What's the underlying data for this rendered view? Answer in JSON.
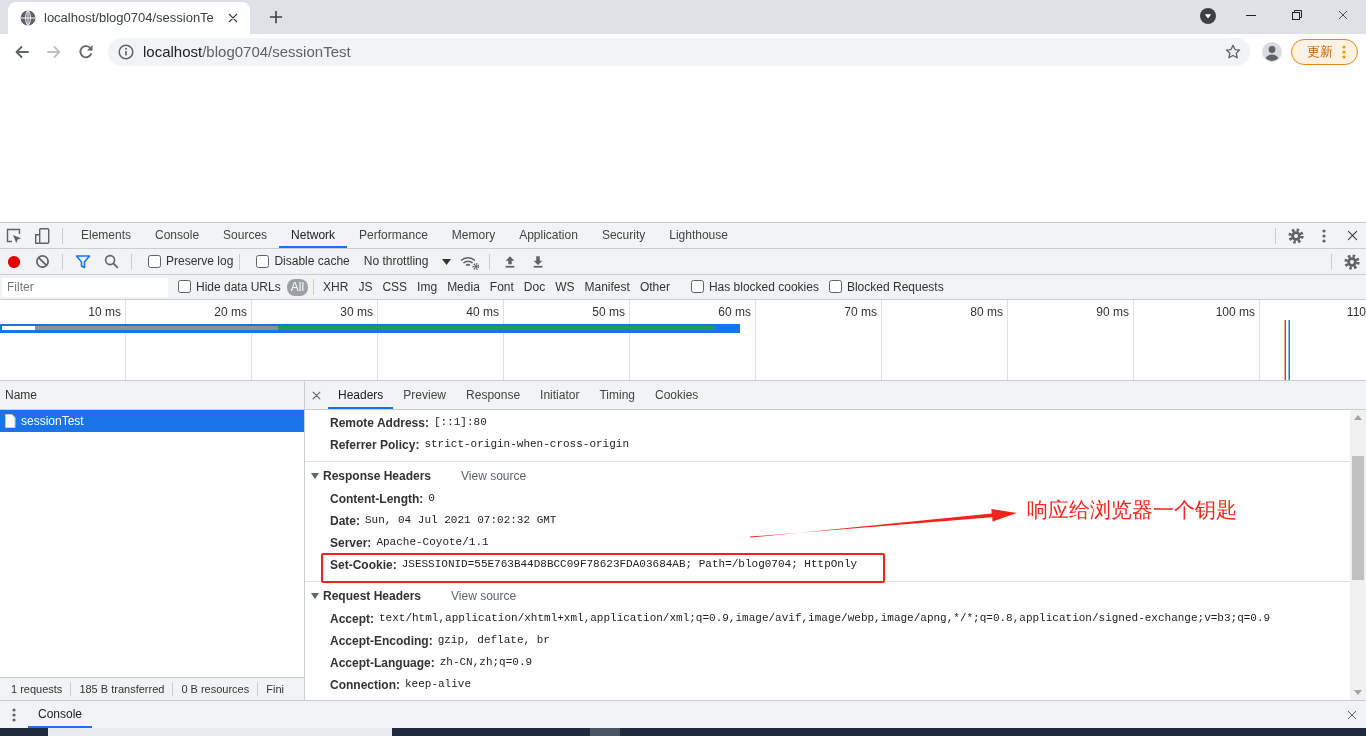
{
  "browser": {
    "tab": {
      "title": "localhost/blog0704/sessionTe"
    },
    "nav_buttons": [
      {
        "kind": "back",
        "disabled": false
      },
      {
        "kind": "forward",
        "disabled": true
      },
      {
        "kind": "reload",
        "disabled": false
      }
    ],
    "address": {
      "host": "localhost",
      "path": "/blog0704/sessionTest"
    },
    "update_button": "更新"
  },
  "devtools": {
    "panel_tabs": [
      {
        "label": "Elements",
        "selected": false
      },
      {
        "label": "Console",
        "selected": false
      },
      {
        "label": "Sources",
        "selected": false
      },
      {
        "label": "Network",
        "selected": true
      },
      {
        "label": "Performance",
        "selected": false
      },
      {
        "label": "Memory",
        "selected": false
      },
      {
        "label": "Application",
        "selected": false
      },
      {
        "label": "Security",
        "selected": false
      },
      {
        "label": "Lighthouse",
        "selected": false
      }
    ],
    "toolbar": {
      "recording": true,
      "filter_active": true,
      "checkboxes": [
        {
          "label": "Preserve log",
          "checked": false
        },
        {
          "label": "Disable cache",
          "checked": false
        }
      ],
      "throttling": "No throttling"
    },
    "filter_bar": {
      "placeholder": "Filter",
      "hide_data_urls": {
        "label": "Hide data URLs",
        "checked": false
      },
      "types": [
        {
          "label": "All",
          "selected": true
        },
        {
          "label": "XHR",
          "selected": false
        },
        {
          "label": "JS",
          "selected": false
        },
        {
          "label": "CSS",
          "selected": false
        },
        {
          "label": "Img",
          "selected": false
        },
        {
          "label": "Media",
          "selected": false
        },
        {
          "label": "Font",
          "selected": false
        },
        {
          "label": "Doc",
          "selected": false
        },
        {
          "label": "WS",
          "selected": false
        },
        {
          "label": "Manifest",
          "selected": false
        },
        {
          "label": "Other",
          "selected": false
        }
      ],
      "options": [
        {
          "label": "Has blocked cookies",
          "checked": false
        },
        {
          "label": "Blocked Requests",
          "checked": false
        }
      ]
    },
    "overview": {
      "ticks": [
        "10 ms",
        "20 ms",
        "30 ms",
        "40 ms",
        "50 ms",
        "60 ms",
        "70 ms",
        "80 ms",
        "90 ms",
        "100 ms",
        "110"
      ]
    },
    "request_list": {
      "column": "Name",
      "rows": [
        {
          "name": "sessionTest",
          "selected": true
        }
      ],
      "summary": [
        "1 requests",
        "185 B transferred",
        "0 B resources",
        "Fini"
      ]
    },
    "details": {
      "tabs": [
        {
          "label": "Headers",
          "selected": true
        },
        {
          "label": "Preview",
          "selected": false
        },
        {
          "label": "Response",
          "selected": false
        },
        {
          "label": "Initiator",
          "selected": false
        },
        {
          "label": "Timing",
          "selected": false
        },
        {
          "label": "Cookies",
          "selected": false
        }
      ],
      "general": [
        {
          "name": "Remote Address:",
          "value": "[::1]:80"
        },
        {
          "name": "Referrer Policy:",
          "value": "strict-origin-when-cross-origin"
        }
      ],
      "sections": [
        {
          "title": "Response Headers",
          "expanded": true,
          "link": "View source",
          "headers": [
            {
              "name": "Content-Length:",
              "value": "0",
              "highlighted": false
            },
            {
              "name": "Date:",
              "value": "Sun, 04 Jul 2021 07:02:32 GMT",
              "highlighted": false
            },
            {
              "name": "Server:",
              "value": "Apache-Coyote/1.1",
              "highlighted": false
            },
            {
              "name": "Set-Cookie:",
              "value": "JSESSIONID=55E763B44D8BCC09F78623FDA03684AB; Path=/blog0704; HttpOnly",
              "highlighted": true
            }
          ]
        },
        {
          "title": "Request Headers",
          "expanded": true,
          "link": "View source",
          "headers": [
            {
              "name": "Accept:",
              "value": "text/html,application/xhtml+xml,application/xml;q=0.9,image/avif,image/webp,image/apng,*/*;q=0.8,application/signed-exchange;v=b3;q=0.9",
              "highlighted": false
            },
            {
              "name": "Accept-Encoding:",
              "value": "gzip, deflate, br",
              "highlighted": false
            },
            {
              "name": "Accept-Language:",
              "value": "zh-CN,zh;q=0.9",
              "highlighted": false
            },
            {
              "name": "Connection:",
              "value": "keep-alive",
              "highlighted": false
            }
          ]
        }
      ]
    },
    "drawer": {
      "tabs": [
        {
          "label": "Console",
          "selected": true
        }
      ]
    }
  },
  "annotation": {
    "text": "响应给浏览器一个钥匙"
  }
}
